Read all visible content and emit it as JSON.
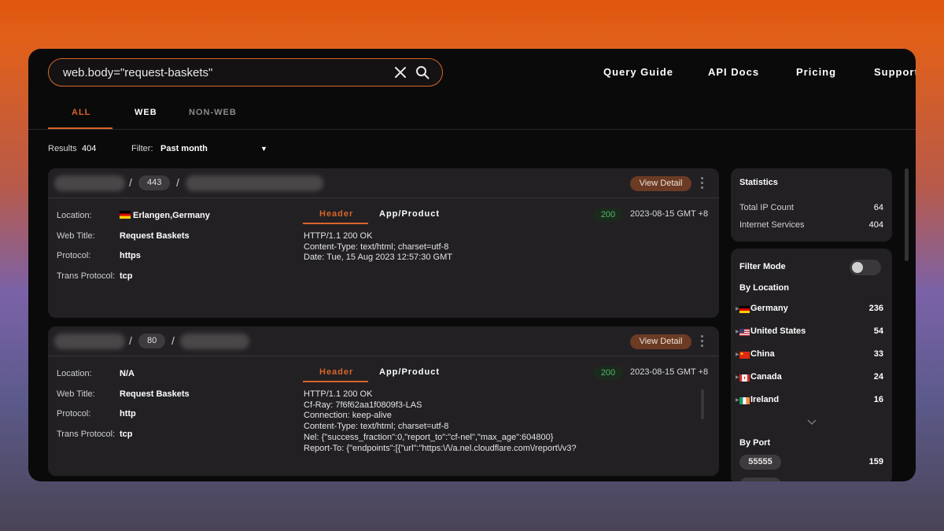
{
  "search": {
    "query": "web.body=\"request-baskets\""
  },
  "nav": {
    "links": [
      "Query Guide",
      "API Docs",
      "Pricing",
      "Support"
    ]
  },
  "tabs": [
    {
      "label": "ALL",
      "active": true
    },
    {
      "label": "WEB",
      "active": false
    },
    {
      "label": "NON-WEB",
      "active": false
    }
  ],
  "results": {
    "label": "Results",
    "count": "404",
    "filter_label": "Filter:",
    "filter_value": "Past month"
  },
  "cards": [
    {
      "port": "443",
      "view_label": "View Detail",
      "fields": [
        {
          "label": "Location:",
          "value": "Erlangen,Germany"
        },
        {
          "label": "Web Title:",
          "value": "Request Baskets"
        },
        {
          "label": "Protocol:",
          "value": "https"
        },
        {
          "label": "Trans Protocol:",
          "value": "tcp"
        }
      ],
      "detail_tabs": [
        "Header",
        "App/Product"
      ],
      "status": "200",
      "date": "2023-08-15 GMT +8",
      "http": "HTTP/1.1 200 OK\nContent-Type: text/html; charset=utf-8\nDate: Tue, 15 Aug 2023 12:57:30 GMT"
    },
    {
      "port": "80",
      "view_label": "View Detail",
      "fields": [
        {
          "label": "Location:",
          "value": "N/A"
        },
        {
          "label": "Web Title:",
          "value": "Request Baskets"
        },
        {
          "label": "Protocol:",
          "value": "http"
        },
        {
          "label": "Trans Protocol:",
          "value": "tcp"
        }
      ],
      "detail_tabs": [
        "Header",
        "App/Product"
      ],
      "status": "200",
      "date": "2023-08-15 GMT +8",
      "http": "HTTP/1.1 200 OK\nCf-Ray: 7f6f62aa1f0809f3-LAS\nConnection: keep-alive\nContent-Type: text/html; charset=utf-8\nNel: {\"success_fraction\":0,\"report_to\":\"cf-nel\",\"max_age\":604800}\nReport-To: {\"endpoints\":[{\"url\":\"https:\\/\\/a.nel.cloudflare.com\\/report\\/v3?"
    }
  ],
  "statistics": {
    "title": "Statistics",
    "rows": [
      {
        "label": "Total IP Count",
        "value": "64"
      },
      {
        "label": "Internet Services",
        "value": "404"
      }
    ]
  },
  "filters": {
    "mode_label": "Filter Mode",
    "mode_on": false,
    "by_location_label": "By Location",
    "locations": [
      {
        "name": "Germany",
        "count": "236",
        "flag": "de"
      },
      {
        "name": "United States",
        "count": "54",
        "flag": "us"
      },
      {
        "name": "China",
        "count": "33",
        "flag": "cn"
      },
      {
        "name": "Canada",
        "count": "24",
        "flag": "ca"
      },
      {
        "name": "Ireland",
        "count": "16",
        "flag": "ie"
      }
    ],
    "by_port_label": "By Port",
    "ports": [
      {
        "port": "55555",
        "count": "159"
      }
    ]
  },
  "colors": {
    "accent": "#d9652a",
    "status_ok": "#4fb864",
    "panel": "#222023",
    "background": "#0b0a0b"
  }
}
